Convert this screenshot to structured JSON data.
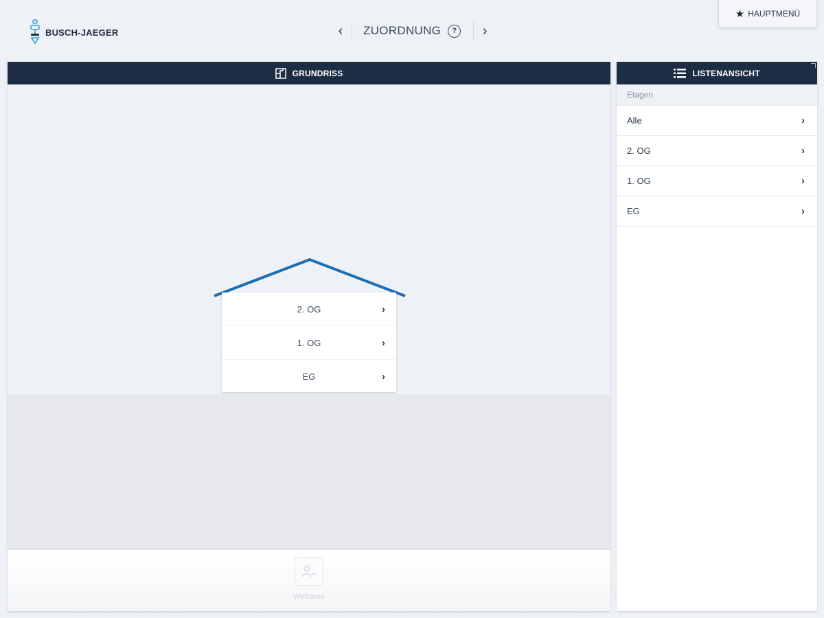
{
  "header": {
    "brand": "BUSCH-JAEGER",
    "title": "ZUORDNUNG",
    "help_symbol": "?",
    "prev_icon": "chevron-left-icon",
    "next_icon": "chevron-right-icon",
    "main_menu_label": "HAUPTMENÜ",
    "main_menu_icon": "star-icon"
  },
  "floorplan": {
    "title": "GRUNDRISS",
    "icon": "floorplan-icon",
    "floors": [
      "2. OG",
      "1. OG",
      "EG"
    ],
    "roof_color": "#1a6fb5"
  },
  "list_view": {
    "title": "LISTENANSICHT",
    "icon": "list-icon",
    "section_label": "Etagen",
    "items": [
      "Alle",
      "2. OG",
      "1. OG",
      "EG"
    ]
  },
  "bottom_bar": {
    "item_label": "Welcome",
    "item_icon": "welcome-icon"
  },
  "colors": {
    "header_dark": "#1d2e44",
    "accent_blue": "#1a6fb5",
    "background": "#eef1f5"
  }
}
